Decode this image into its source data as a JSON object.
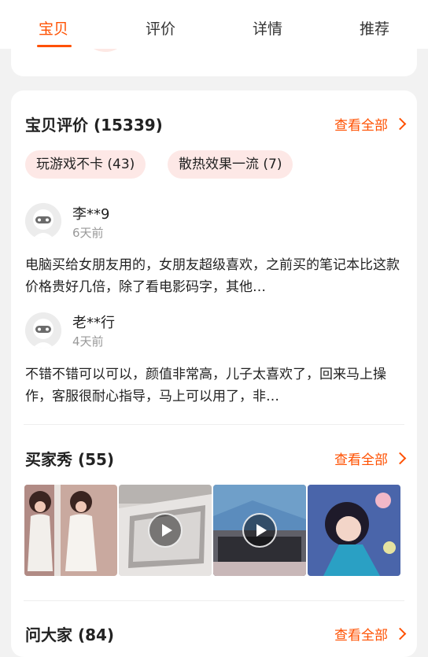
{
  "tabs": [
    {
      "label": "宝贝",
      "active": true
    },
    {
      "label": "评价",
      "active": false
    },
    {
      "label": "详情",
      "active": false
    },
    {
      "label": "推荐",
      "active": false
    }
  ],
  "reviews_section": {
    "title": "宝贝评价 (15339)",
    "see_all": "查看全部",
    "tags": [
      "玩游戏不卡 (43)",
      "散热效果一流 (7)"
    ],
    "items": [
      {
        "user": "李**9",
        "time": "6天前",
        "text": "电脑买给女朋友用的，女朋友超级喜欢，之前买的笔记本比这款价格贵好几倍，除了看电影码字，其他…"
      },
      {
        "user": "老**行",
        "time": "4天前",
        "text": "不错不错可以可以，颜值非常高，儿子太喜欢了，回来马上操作，客服很耐心指导，马上可以用了，非…"
      }
    ]
  },
  "buyer_show": {
    "title": "买家秀 (55)",
    "see_all": "查看全部"
  },
  "qa": {
    "title": "问大家 (84)",
    "see_all": "查看全部"
  },
  "colors": {
    "accent": "#ff5000",
    "chip_bg": "#fde8e6"
  }
}
